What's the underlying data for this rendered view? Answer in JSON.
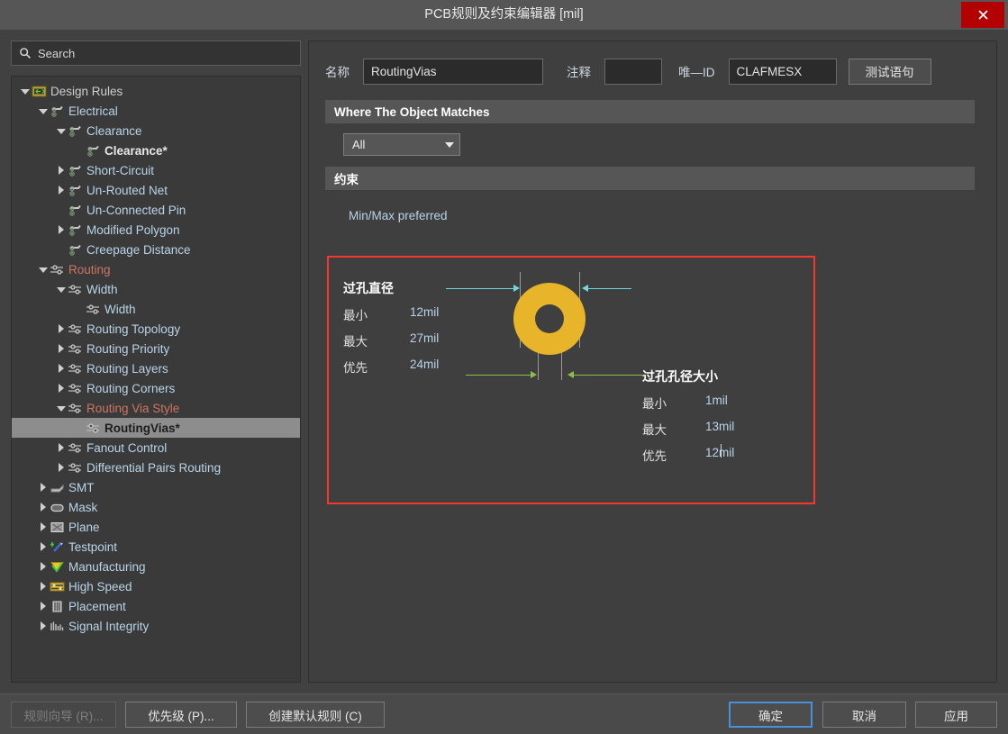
{
  "window": {
    "title": "PCB规则及约束编辑器 [mil]",
    "close_icon": "close-icon"
  },
  "sidebar": {
    "search": {
      "placeholder": "Search",
      "icon": "search-icon"
    },
    "tree": [
      {
        "label": "Design Rules",
        "indent": 0,
        "twisty": "open",
        "icon": "folder-rules-icon",
        "color": "cl-root",
        "selected": false
      },
      {
        "label": "Electrical",
        "indent": 1,
        "twisty": "open",
        "icon": "electrical-icon",
        "color": "",
        "selected": false
      },
      {
        "label": "Clearance",
        "indent": 2,
        "twisty": "open",
        "icon": "electrical-icon",
        "color": "",
        "selected": false
      },
      {
        "label": "Clearance*",
        "indent": 3,
        "twisty": "none",
        "icon": "electrical-icon",
        "color": "bold",
        "selected": false
      },
      {
        "label": "Short-Circuit",
        "indent": 2,
        "twisty": "closed",
        "icon": "electrical-icon",
        "color": "",
        "selected": false
      },
      {
        "label": "Un-Routed Net",
        "indent": 2,
        "twisty": "closed",
        "icon": "electrical-icon",
        "color": "",
        "selected": false
      },
      {
        "label": "Un-Connected Pin",
        "indent": 2,
        "twisty": "none",
        "icon": "electrical-icon",
        "color": "",
        "selected": false
      },
      {
        "label": "Modified Polygon",
        "indent": 2,
        "twisty": "closed",
        "icon": "electrical-icon",
        "color": "",
        "selected": false
      },
      {
        "label": "Creepage Distance",
        "indent": 2,
        "twisty": "none",
        "icon": "electrical-icon",
        "color": "",
        "selected": false
      },
      {
        "label": "Routing",
        "indent": 1,
        "twisty": "open",
        "icon": "routing-icon",
        "color": "cl-red",
        "selected": false
      },
      {
        "label": "Width",
        "indent": 2,
        "twisty": "open",
        "icon": "routing-icon",
        "color": "",
        "selected": false
      },
      {
        "label": "Width",
        "indent": 3,
        "twisty": "none",
        "icon": "routing-icon",
        "color": "",
        "selected": false
      },
      {
        "label": "Routing Topology",
        "indent": 2,
        "twisty": "closed",
        "icon": "routing-icon",
        "color": "",
        "selected": false
      },
      {
        "label": "Routing Priority",
        "indent": 2,
        "twisty": "closed",
        "icon": "routing-icon",
        "color": "",
        "selected": false
      },
      {
        "label": "Routing Layers",
        "indent": 2,
        "twisty": "closed",
        "icon": "routing-icon",
        "color": "",
        "selected": false
      },
      {
        "label": "Routing Corners",
        "indent": 2,
        "twisty": "closed",
        "icon": "routing-icon",
        "color": "",
        "selected": false
      },
      {
        "label": "Routing Via Style",
        "indent": 2,
        "twisty": "open",
        "icon": "routing-icon",
        "color": "cl-red",
        "selected": false
      },
      {
        "label": "RoutingVias*",
        "indent": 3,
        "twisty": "none",
        "icon": "routing-icon",
        "color": "bold",
        "selected": true
      },
      {
        "label": "Fanout Control",
        "indent": 2,
        "twisty": "closed",
        "icon": "routing-icon",
        "color": "",
        "selected": false
      },
      {
        "label": "Differential Pairs Routing",
        "indent": 2,
        "twisty": "closed",
        "icon": "routing-icon",
        "color": "",
        "selected": false
      },
      {
        "label": "SMT",
        "indent": 1,
        "twisty": "closed",
        "icon": "smt-icon",
        "color": "",
        "selected": false
      },
      {
        "label": "Mask",
        "indent": 1,
        "twisty": "closed",
        "icon": "mask-icon",
        "color": "",
        "selected": false
      },
      {
        "label": "Plane",
        "indent": 1,
        "twisty": "closed",
        "icon": "plane-icon",
        "color": "",
        "selected": false
      },
      {
        "label": "Testpoint",
        "indent": 1,
        "twisty": "closed",
        "icon": "testpoint-icon",
        "color": "",
        "selected": false
      },
      {
        "label": "Manufacturing",
        "indent": 1,
        "twisty": "closed",
        "icon": "manufacturing-icon",
        "color": "",
        "selected": false
      },
      {
        "label": "High Speed",
        "indent": 1,
        "twisty": "closed",
        "icon": "highspeed-icon",
        "color": "",
        "selected": false
      },
      {
        "label": "Placement",
        "indent": 1,
        "twisty": "closed",
        "icon": "placement-icon",
        "color": "",
        "selected": false
      },
      {
        "label": "Signal Integrity",
        "indent": 1,
        "twisty": "closed",
        "icon": "signal-icon",
        "color": "",
        "selected": false
      }
    ]
  },
  "form": {
    "name_label": "名称",
    "name_value": "RoutingVias",
    "comment_label": "注释",
    "comment_value": "",
    "uid_label": "唯—ID",
    "uid_value": "CLAFMESX",
    "test_button": "测试语句"
  },
  "match_section": {
    "header": "Where The Object Matches",
    "scope_value": "All",
    "caret_icon": "chevron-down-icon"
  },
  "constraint_section": {
    "header": "约束",
    "minmax_label": "Min/Max preferred"
  },
  "diagram": {
    "border_color": "#f4382c",
    "via_color": "#e8b52a",
    "top_arrow_color": "#6fd9d9",
    "bottom_arrow_color": "#8cbf4a",
    "via_diameter": {
      "title": "过孔直径",
      "rows": [
        {
          "label": "最小",
          "value": "12mil"
        },
        {
          "label": "最大",
          "value": "27mil"
        },
        {
          "label": "优先",
          "value": "24mil"
        }
      ]
    },
    "via_hole_size": {
      "title": "过孔孔径大小",
      "rows": [
        {
          "label": "最小",
          "value": "1mil"
        },
        {
          "label": "最大",
          "value": "13mil"
        },
        {
          "label": "优先",
          "value": "12mil"
        }
      ]
    }
  },
  "footer": {
    "rule_wizard": "规则向导 (R)...",
    "priority": "优先级 (P)...",
    "create_default": "创建默认规则 (C)",
    "ok": "确定",
    "cancel": "取消",
    "apply": "应用"
  }
}
